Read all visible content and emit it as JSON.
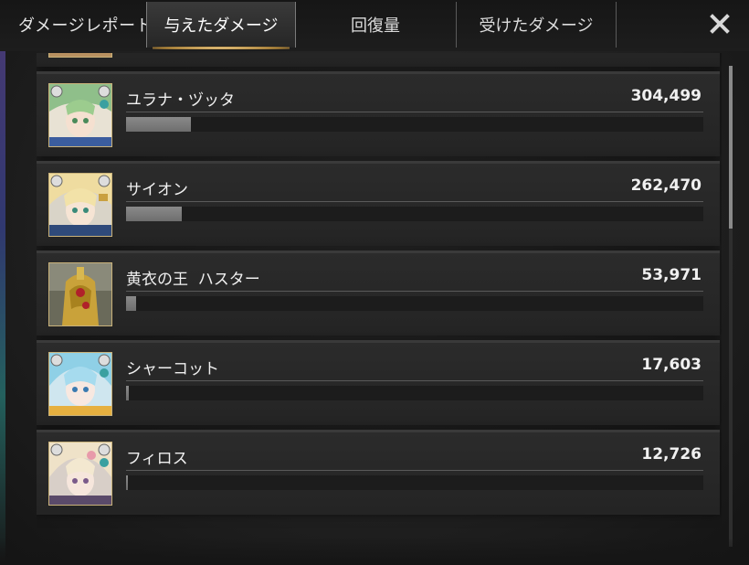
{
  "header": {
    "title": "ダメージレポート",
    "tabs": [
      {
        "label": "与えたダメージ",
        "active": true
      },
      {
        "label": "回復量",
        "active": false
      },
      {
        "label": "受けたダメージ",
        "active": false
      }
    ]
  },
  "rows": [
    {
      "name": "ユラナ・ヅッタ",
      "value": "304,499",
      "fill_fraction": 0.112,
      "portrait": "green-hair-character"
    },
    {
      "name": "サイオン",
      "value": "262,470",
      "fill_fraction": 0.097,
      "portrait": "blonde-hair-character"
    },
    {
      "name": "黄衣の王  ハスター",
      "value": "53,971",
      "fill_fraction": 0.017,
      "portrait": "golden-king-character"
    },
    {
      "name": "シャーコット",
      "value": "17,603",
      "fill_fraction": 0.004,
      "portrait": "light-blue-hair-character"
    },
    {
      "name": "フィロス",
      "value": "12,726",
      "fill_fraction": 0.003,
      "portrait": "pale-blonde-hair-character"
    }
  ],
  "colors": {
    "accent": "#c9b27a",
    "bar": "#7a7a7a",
    "text": "#f0f0f0"
  }
}
